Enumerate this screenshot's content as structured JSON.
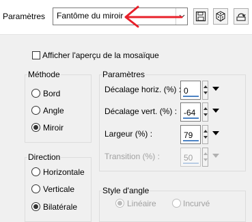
{
  "header": {
    "preset_label": "Paramètres",
    "preset_value": "Fantôme du miroir",
    "save_icon": "save-icon",
    "random_icon": "dice-icon",
    "reset_icon": "reset-icon"
  },
  "annotation_color": "#e8202a",
  "preview": {
    "label": "Afficher l'aperçu de la mosaïque",
    "checked": false
  },
  "methode": {
    "title": "Méthode",
    "options": [
      "Bord",
      "Angle",
      "Miroir"
    ],
    "selected": "Miroir"
  },
  "direction": {
    "title": "Direction",
    "options": [
      "Horizontale",
      "Verticale",
      "Bilatérale"
    ],
    "selected": "Bilatérale"
  },
  "parametres": {
    "title": "Paramètres",
    "fields": [
      {
        "label": "Décalage horiz. (%) :",
        "value": "0",
        "enabled": true
      },
      {
        "label": "Décalage vert. (%) :",
        "value": "-64",
        "enabled": true
      },
      {
        "label": "Largeur (%) :",
        "value": "79",
        "enabled": true
      },
      {
        "label": "Transition (%) :",
        "value": "50",
        "enabled": false
      }
    ]
  },
  "style_angle": {
    "title": "Style d'angle",
    "options": [
      "Linéaire",
      "Incurvé"
    ],
    "selected": "Linéaire",
    "enabled": false
  }
}
